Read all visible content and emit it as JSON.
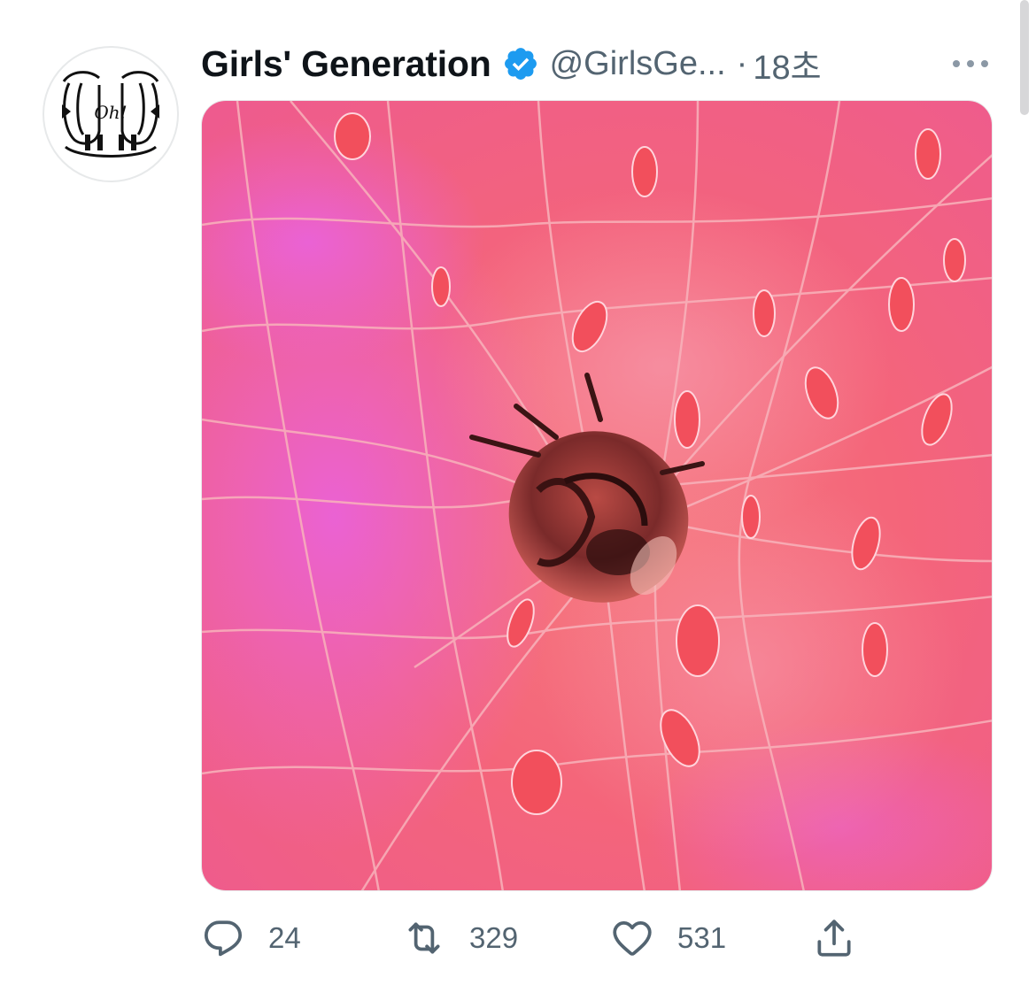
{
  "tweet": {
    "display_name": "Girls' Generation",
    "handle": "@GirlsGe...",
    "separator": "·",
    "time": "18초",
    "avatar_text": "Oh!",
    "stats": {
      "replies": "24",
      "retweets": "329",
      "likes": "531"
    }
  },
  "icons": {
    "verified": "verified-badge-icon",
    "more": "more-icon",
    "reply": "reply-icon",
    "retweet": "retweet-icon",
    "like": "heart-icon",
    "share": "share-icon"
  },
  "colors": {
    "verified": "#1d9bf0",
    "text_primary": "#0f1419",
    "text_secondary": "#536471",
    "image_pink": "#ee6fb3",
    "image_coral": "#f5655e"
  }
}
